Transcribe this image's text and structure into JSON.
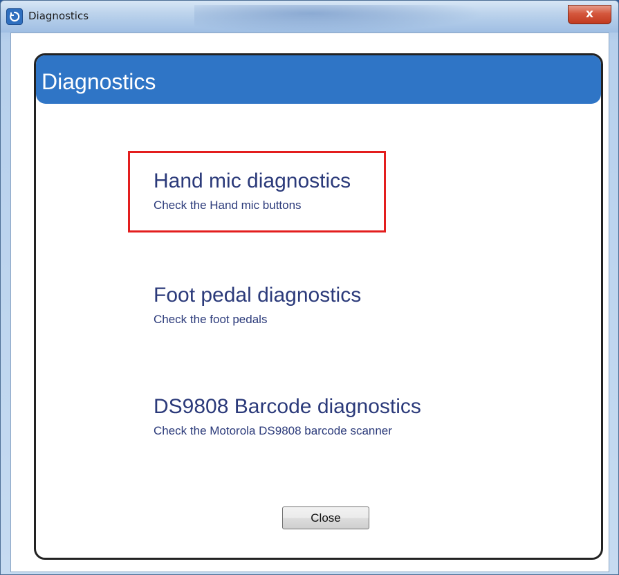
{
  "window": {
    "title": "Diagnostics",
    "close_glyph": "x",
    "icon": "app-icon"
  },
  "panel": {
    "title": "Diagnostics",
    "header_color": "#2f75c6"
  },
  "options": [
    {
      "title": "Hand mic diagnostics",
      "subtitle": "Check the Hand mic buttons",
      "highlighted": true
    },
    {
      "title": "Foot pedal diagnostics",
      "subtitle": "Check the foot pedals",
      "highlighted": false
    },
    {
      "title": "DS9808 Barcode diagnostics",
      "subtitle": "Check the Motorola DS9808 barcode scanner",
      "highlighted": false
    }
  ],
  "buttons": {
    "close_label": "Close"
  },
  "colors": {
    "link_text": "#2b3a7a",
    "highlight_border": "#e31e1e"
  }
}
